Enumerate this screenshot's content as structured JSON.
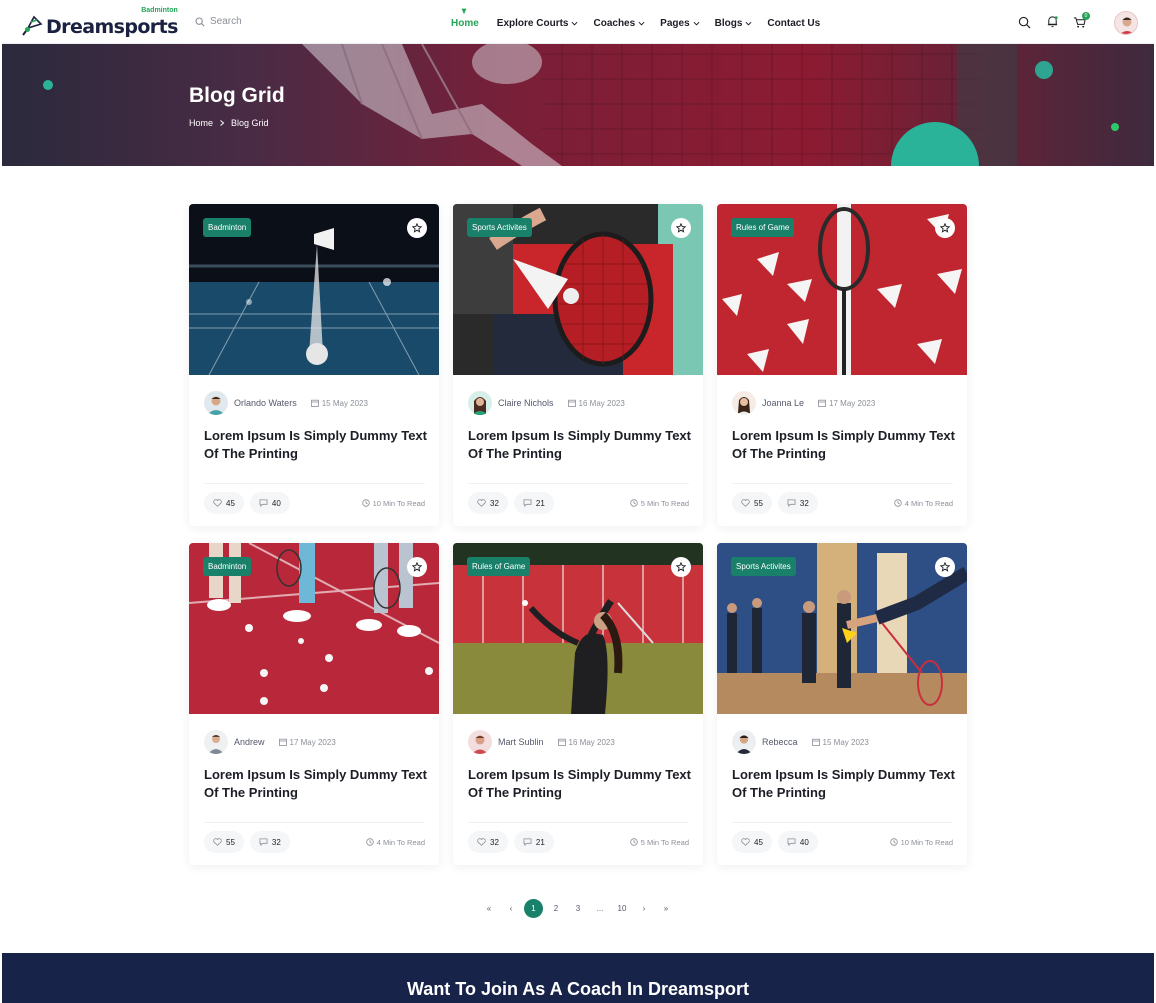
{
  "brand": {
    "name": "Dreamsports",
    "tagline": "Badminton"
  },
  "search": {
    "placeholder": "Search"
  },
  "nav": {
    "items": [
      {
        "label": "Home",
        "active": true,
        "dropdown": false
      },
      {
        "label": "Explore Courts",
        "active": false,
        "dropdown": true
      },
      {
        "label": "Coaches",
        "active": false,
        "dropdown": true
      },
      {
        "label": "Pages",
        "active": false,
        "dropdown": true
      },
      {
        "label": "Blogs",
        "active": false,
        "dropdown": true
      },
      {
        "label": "Contact Us",
        "active": false,
        "dropdown": false
      }
    ]
  },
  "header_icons": [
    "search-icon",
    "bell-icon",
    "cart-icon",
    "user-avatar"
  ],
  "cart_count": "0",
  "hero": {
    "title": "Blog Grid",
    "breadcrumb": [
      "Home",
      "Blog Grid"
    ]
  },
  "posts": [
    {
      "badge": "Badminton",
      "author": "Orlando Waters",
      "date": "15 May 2023",
      "title": "Lorem Ipsum Is Simply Dummy Text Of The Printing",
      "likes": "45",
      "comments": "40",
      "read_time": "10 Min To Read",
      "image": "night-court"
    },
    {
      "badge": "Sports Activites",
      "author": "Claire Nichols",
      "date": "16 May 2023",
      "title": "Lorem Ipsum Is Simply Dummy Text Of The Printing",
      "likes": "32",
      "comments": "21",
      "read_time": "5 Min To Read",
      "image": "racket-red"
    },
    {
      "badge": "Rules of Game",
      "author": "Joanna Le",
      "date": "17 May 2023",
      "title": "Lorem Ipsum Is Simply Dummy Text Of The Printing",
      "likes": "55",
      "comments": "32",
      "read_time": "4 Min To Read",
      "image": "shuttles-red"
    },
    {
      "badge": "Badminton",
      "author": "Andrew",
      "date": "17 May 2023",
      "title": "Lorem Ipsum Is Simply Dummy Text Of The Printing",
      "likes": "55",
      "comments": "32",
      "read_time": "4 Min To Read",
      "image": "red-floor"
    },
    {
      "badge": "Rules of Game",
      "author": "Mart Sublin",
      "date": "16 May 2023",
      "title": "Lorem Ipsum Is Simply Dummy Text Of The Printing",
      "likes": "32",
      "comments": "21",
      "read_time": "5 Min To Read",
      "image": "outdoor-player"
    },
    {
      "badge": "Sports Activites",
      "author": "Rebecca",
      "date": "15 May 2023",
      "title": "Lorem Ipsum Is Simply Dummy Text Of The Printing",
      "likes": "45",
      "comments": "40",
      "read_time": "10 Min To Read",
      "image": "indoor-hall"
    }
  ],
  "pagination": {
    "first": "«",
    "prev": "‹",
    "pages": [
      "1",
      "2",
      "3",
      "...",
      "10"
    ],
    "current": "1",
    "next": "›",
    "last": "»"
  },
  "cta": {
    "title": "Want To Join As A Coach In Dreamsport"
  },
  "colors": {
    "accent": "#19806a",
    "brand_green": "#23a457",
    "navy": "#18234a"
  }
}
